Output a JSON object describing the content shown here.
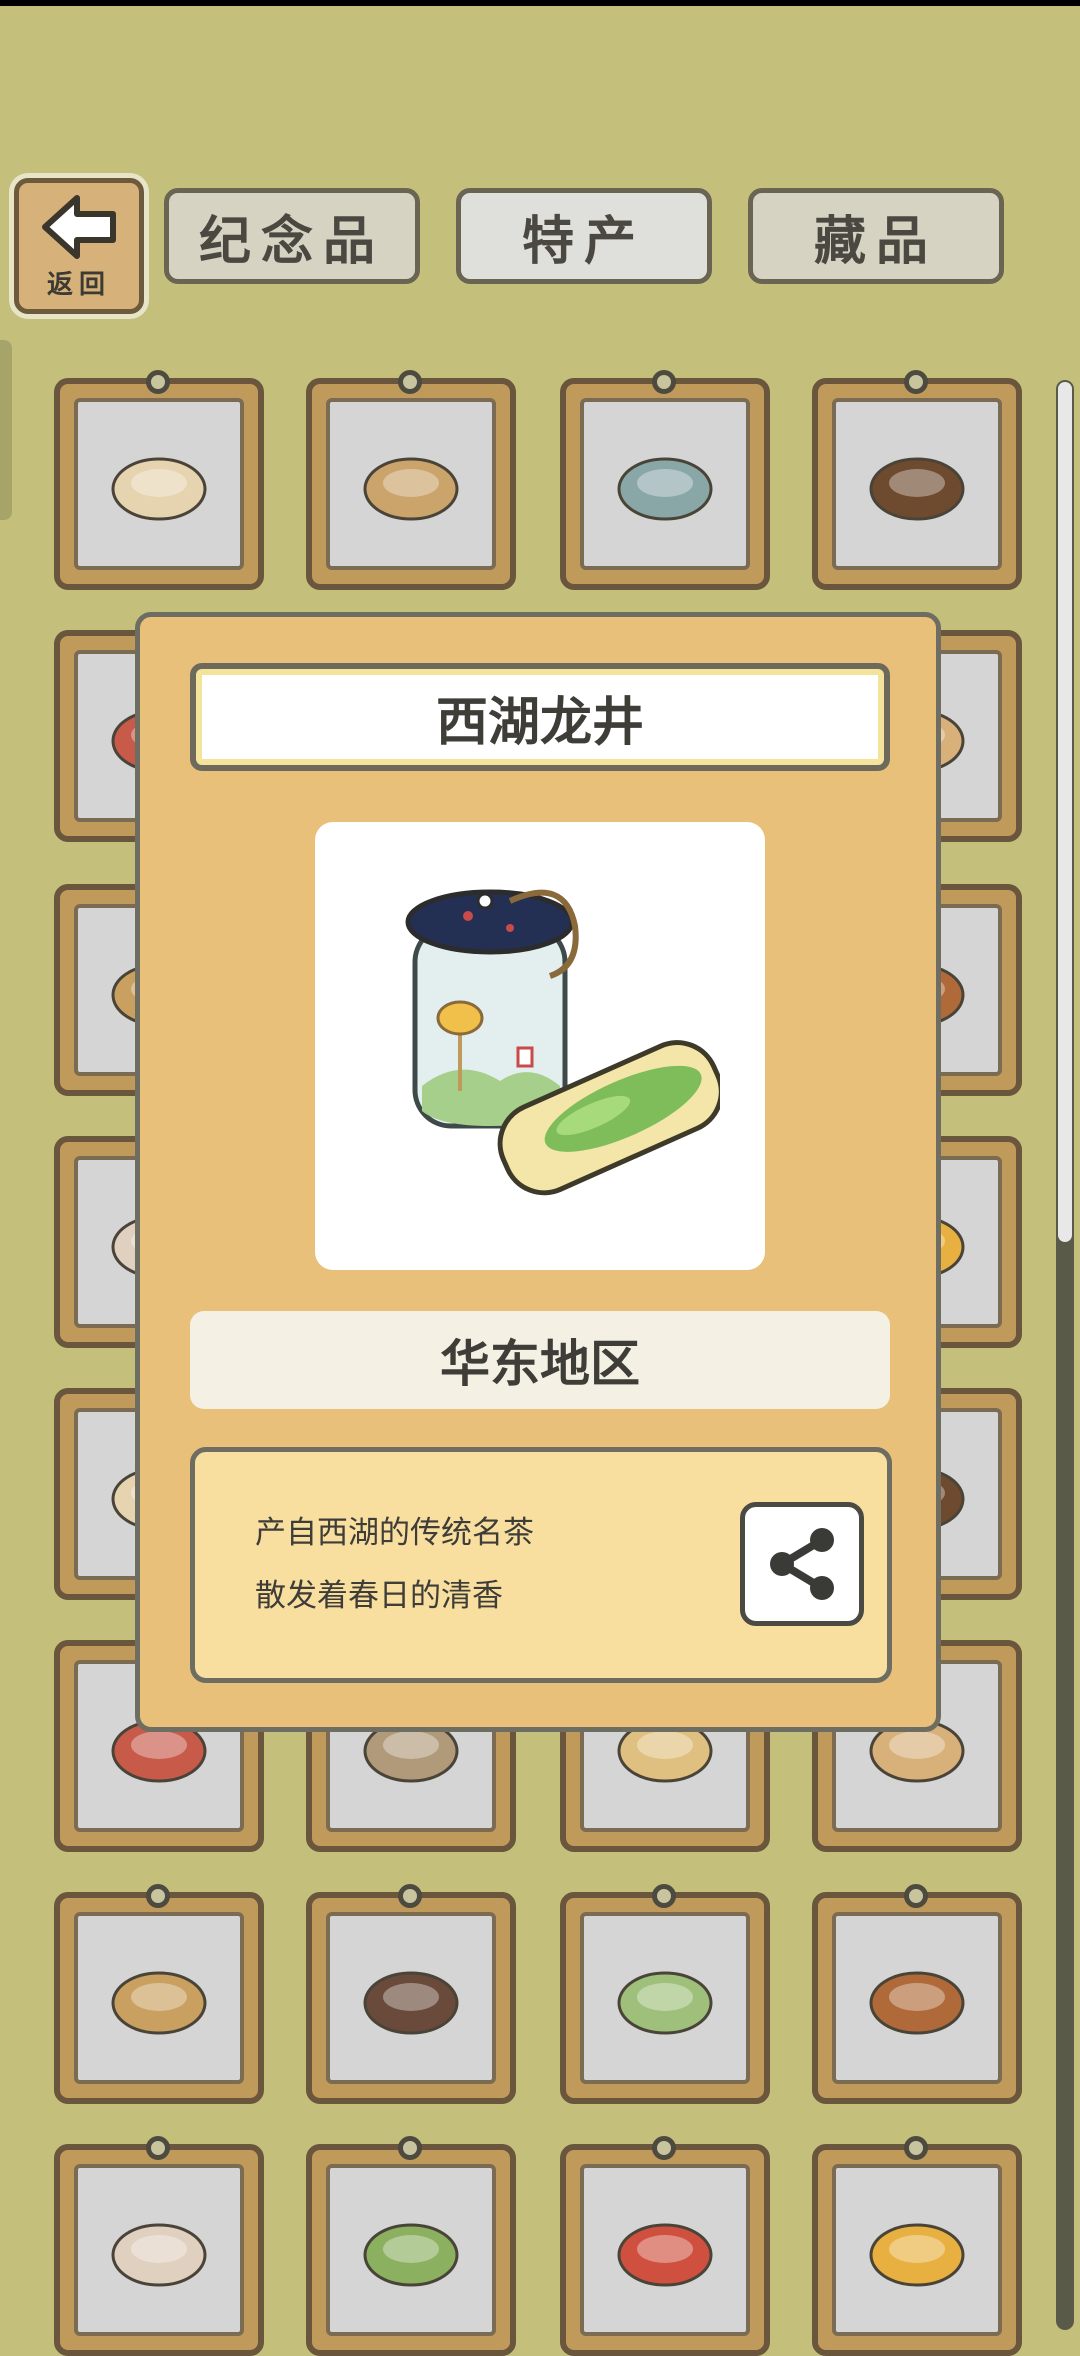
{
  "header": {
    "back_label": "返回",
    "tabs": [
      {
        "label": "纪念品"
      },
      {
        "label": "特产"
      },
      {
        "label": "藏品"
      }
    ]
  },
  "grid": {
    "items": [
      "rice-porridge-icon",
      "tofu-icon",
      "longjing-tea-icon",
      "coffee-beans-icon",
      "gift-box-icon",
      "",
      "",
      "snack-bag-icon",
      "ginger-icon",
      "",
      "",
      "bowl-icon",
      "buns-icon",
      "",
      "",
      "dumplings-icon",
      "chili-bowl-icon",
      "",
      "",
      "soup-bowl-icon",
      "chestnut-bowl-icon",
      "pine-cone-icon",
      "rice-sack-icon",
      "cabbage-icon",
      "onion-icon",
      "garlic-icon",
      "green-onion-icon",
      "chili-pepper-icon",
      "strawberry-icon",
      "persimmon-icon",
      "chestnut-icon",
      "banana-icon"
    ]
  },
  "detail": {
    "title": "西湖龙井",
    "region": "华东地区",
    "desc_line1": "产自西湖的传统名茶",
    "desc_line2": "散发着春日的清香",
    "image_icon": "longjing-tea-jar-icon",
    "share_icon": "share-icon"
  }
}
